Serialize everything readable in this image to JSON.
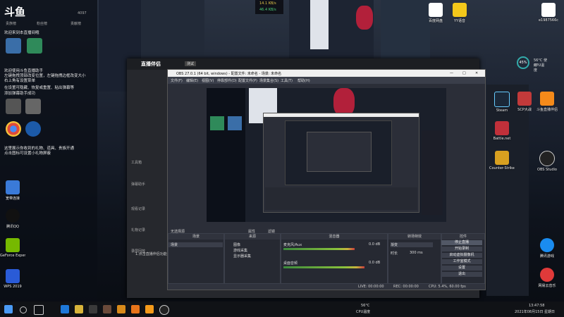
{
  "network": {
    "upload": "14.1 KB/s",
    "download": "46.4 KB/s"
  },
  "douyu_panel": {
    "logo": "斗鱼",
    "tabs": [
      "贵族榜",
      "粉丝榜",
      "贡献榜"
    ],
    "stat": "4097",
    "messages": [
      "欢迎来到本直播间哦",
      "欢迎使用斗鱼直播助手",
      "左键拖拽顶部改变位置，左键拖拽边框改变大小",
      "右上角有设置菜单",
      "在设置可隐藏、恢复或重置、粘出弹幕等",
      "添加弹幕助手成功",
      "这里展示你收到的礼物、道具、贵族开通",
      "点击图标可设置小礼物屏蔽"
    ]
  },
  "broadcast_app": {
    "title": "直播伴侣",
    "badge": "测试",
    "side_items": [
      "工具箱",
      "弹幕助手",
      "观看记录",
      "礼物记录",
      "录屏回放"
    ],
    "footer": "1.点击直播伴侣功能提示"
  },
  "obs": {
    "title": "OBS 27.0.1 (64 bit, windows) - 配置文件: 未命名 - 场景: 未命名",
    "menu": [
      "文件(F)",
      "编辑(E)",
      "视图(V)",
      "停靠部件(D)",
      "配置文件(P)",
      "场景集合(S)",
      "工具(T)",
      "帮助(H)"
    ],
    "no_source": "无选择源",
    "props_label": "属性",
    "filter_label": "滤镜",
    "panels": {
      "scenes": {
        "title": "场景",
        "items": [
          "场景"
        ]
      },
      "sources": {
        "title": "来源",
        "items": [
          "图像",
          "游戏采集",
          "显示器采集"
        ]
      },
      "mixer": {
        "title": "混音器",
        "tracks": [
          {
            "name": "麦克风/Aux",
            "level": "0.0 dB",
            "fill": 0.72
          },
          {
            "name": "桌面音频",
            "level": "0.0 dB",
            "fill": 0.82
          }
        ]
      },
      "transitions": {
        "title": "转场特效",
        "type": "渐变",
        "duration_label": "时长",
        "duration": "300 ms"
      },
      "controls": {
        "title": "控件",
        "buttons": [
          "停止直播",
          "开始录制",
          "启动虚拟摄像机",
          "工作室模式",
          "设置",
          "退出"
        ]
      }
    },
    "status": {
      "live": "LIVE: 00:00:00",
      "rec": "REC: 00:00:00",
      "cpu": "CPU: 5.4%, 60.00 fps"
    }
  },
  "desktop_icons_left": [
    "宽带连接",
    "Steam",
    "Google Chrome",
    "斗鱼直播伴侣",
    "QQ音乐",
    "腾讯QQ",
    "GeForce Experience",
    "WPS 2019"
  ],
  "desktop_icons_right": [
    "百度网盘",
    "YY语音",
    "e1987566c",
    "Steam",
    "SCP大战",
    "斗鱼直播伴侣",
    "Battle.net",
    "Counter-Strike Global Off",
    "OBS Studio",
    "腾讯游戏",
    "网易云音乐"
  ],
  "gauge": {
    "value": "45%",
    "temp": "56°C 使用",
    "label": "CPU温度"
  },
  "taskbar": {
    "temp": "56°C",
    "temp_label": "CPU温度",
    "time": "13:47:58",
    "date": "2021年08月15日 星期日"
  }
}
